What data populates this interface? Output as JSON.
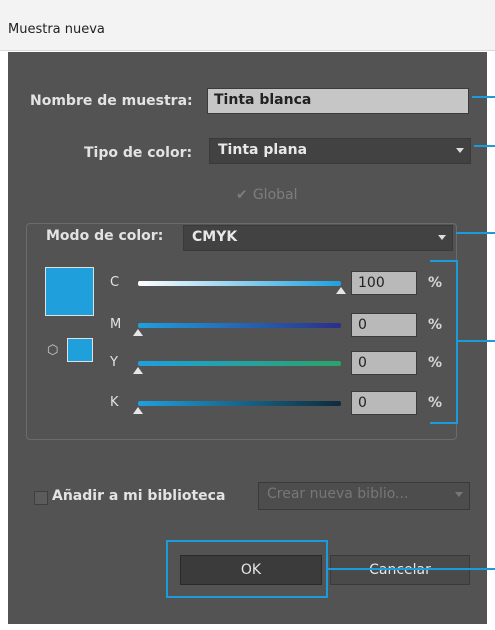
{
  "window": {
    "title": "Muestra nueva"
  },
  "form": {
    "name_label": "Nombre de muestra:",
    "name_value": "Tinta blanca",
    "type_label": "Tipo de color:",
    "type_value": "Tinta plana",
    "global_label": "Global",
    "global_checked": true,
    "mode_label": "Modo de color:",
    "mode_value": "CMYK"
  },
  "color": {
    "swatch": "#1fa0dd",
    "channels": [
      {
        "letter": "C",
        "value": "100",
        "unit": "%",
        "level": 1.0
      },
      {
        "letter": "M",
        "value": "0",
        "unit": "%",
        "level": 0.0
      },
      {
        "letter": "Y",
        "value": "0",
        "unit": "%",
        "level": 0.0
      },
      {
        "letter": "K",
        "value": "0",
        "unit": "%",
        "level": 0.0
      }
    ]
  },
  "library": {
    "add_label": "Añadir a mi biblioteca",
    "add_checked": false,
    "library_select": "Crear nueva biblio..."
  },
  "buttons": {
    "ok": "OK",
    "cancel": "Cancelar"
  },
  "accent": "#1b9bdc"
}
